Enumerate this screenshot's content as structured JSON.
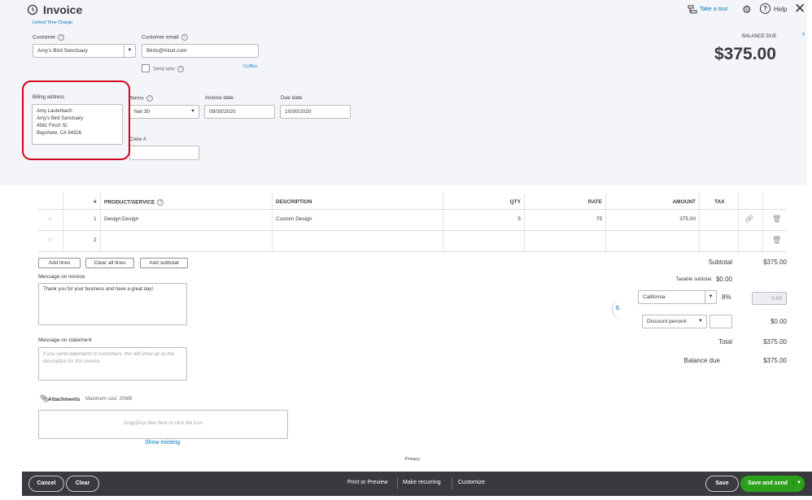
{
  "header": {
    "title": "Invoice",
    "take_tour": "Take a tour",
    "help": "Help"
  },
  "linked": {
    "text": "Linked Time Charge"
  },
  "customer": {
    "label": "Customer",
    "value": "Amy's Bird Sanctuary"
  },
  "email": {
    "label": "Customer email",
    "value": "Birds@Intuit.com",
    "send_later": "Send later",
    "ccbcc": "Cc/Bcc"
  },
  "balance": {
    "label": "BALANCE DUE",
    "amount": "$375.00"
  },
  "billing": {
    "label": "Billing address",
    "lines": [
      "Amy Lauterbach",
      "Amy's Bird Sanctuary",
      "4581 Finch St.",
      "Bayshore, CA  94326"
    ]
  },
  "terms": {
    "label": "Terms",
    "value": "Net 30"
  },
  "invoice_date": {
    "label": "Invoice date",
    "value": "09/30/2020"
  },
  "due_date": {
    "label": "Due date",
    "value": "10/30/2020"
  },
  "crew": {
    "label": "Crew #",
    "value": ""
  },
  "table": {
    "headers": {
      "num": "#",
      "product": "PRODUCT/SERVICE",
      "description": "DESCRIPTION",
      "qty": "QTY",
      "rate": "RATE",
      "amount": "AMOUNT",
      "tax": "TAX"
    },
    "rows": [
      {
        "num": "1",
        "product": "Design:Design",
        "description": "Custom Design",
        "qty": "5",
        "rate": "75",
        "amount": "375.00"
      },
      {
        "num": "2",
        "product": "",
        "description": "",
        "qty": "",
        "rate": "",
        "amount": ""
      }
    ]
  },
  "actions": {
    "add_lines": "Add lines",
    "clear_all": "Clear all lines",
    "add_subtotal": "Add subtotal"
  },
  "totals": {
    "subtotal_label": "Subtotal",
    "subtotal": "$375.00",
    "taxable_label": "Taxable subtotal",
    "taxable": "$0.00",
    "tax_region": "California",
    "tax_rate": "8%",
    "tax_amount": "0.00",
    "discount_type": "Discount percent",
    "discount_value": "",
    "discount_amount": "$0.00",
    "total_label": "Total",
    "total": "$375.00",
    "balance_label": "Balance due",
    "balance": "$375.00"
  },
  "message_invoice": {
    "label": "Message on invoice",
    "value": "Thank you for your business and have a great day!"
  },
  "message_statement": {
    "label": "Message on statement",
    "placeholder": "If you send statements to customers, this will show up as the description for this invoice."
  },
  "attachments": {
    "label": "Attachments",
    "max": "Maximum size: 20MB",
    "drop": "Drag/Drop files here or click the icon",
    "show_existing": "Show existing"
  },
  "privacy": "Privacy",
  "footer": {
    "cancel": "Cancel",
    "clear": "Clear",
    "print": "Print or Preview",
    "recurring": "Make recurring",
    "customize": "Customize",
    "save": "Save",
    "save_send": "Save and send"
  },
  "colors": {
    "accent_green": "#2ca01c",
    "link_blue": "#0077c5",
    "highlight_red": "#d0021b",
    "footer_bg": "#393a3d"
  }
}
